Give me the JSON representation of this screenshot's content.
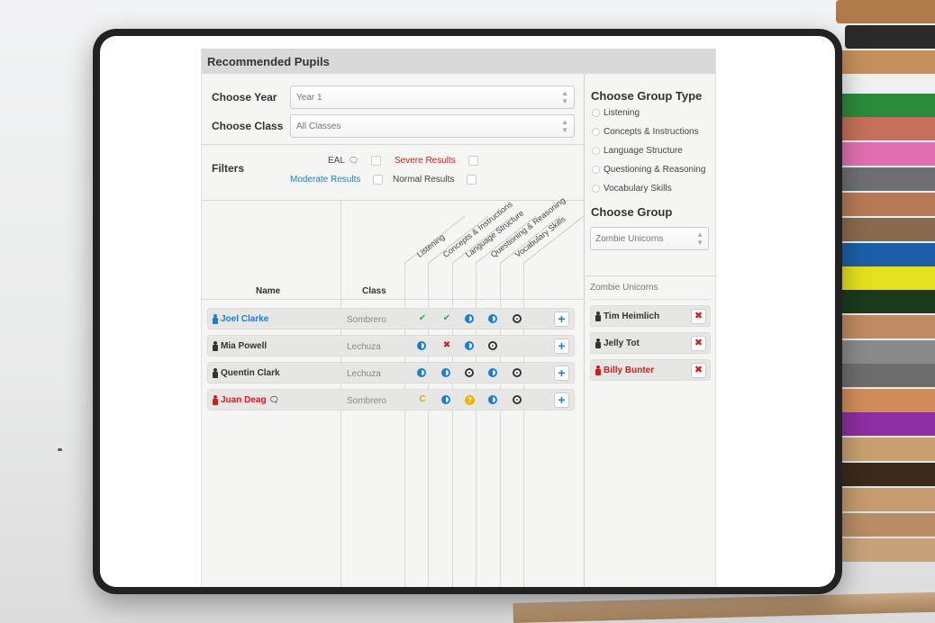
{
  "header": {
    "title": "Recommended Pupils"
  },
  "selectors": {
    "year_label": "Choose Year",
    "year_value": "Year 1",
    "class_label": "Choose Class",
    "class_value": "All Classes"
  },
  "filters": {
    "label": "Filters",
    "eal": "EAL",
    "severe": "Severe Results",
    "moderate": "Moderate Results",
    "normal": "Normal Results"
  },
  "table": {
    "name_header": "Name",
    "class_header": "Class",
    "skill_headers": [
      "Listening",
      "Concepts & Instructions",
      "Language Structure",
      "Questioning & Reasoning",
      "Vocabulary Skills"
    ],
    "rows": [
      {
        "name": "Joel Clarke",
        "class": "Sombrero",
        "color": "#1a7ed6",
        "eal": false,
        "scores": [
          "check",
          "check",
          "half",
          "half",
          "target"
        ]
      },
      {
        "name": "Mia Powell",
        "class": "Lechuza",
        "color": "#333333",
        "eal": false,
        "scores": [
          "half",
          "cross",
          "half",
          "target",
          ""
        ]
      },
      {
        "name": "Quentin Clark",
        "class": "Lechuza",
        "color": "#333333",
        "eal": false,
        "scores": [
          "half",
          "half",
          "target",
          "half",
          "target"
        ]
      },
      {
        "name": "Juan Deag",
        "class": "Sombrero",
        "color": "#d21c1c",
        "eal": true,
        "scores": [
          "cycle",
          "half",
          "question",
          "half",
          "target"
        ]
      }
    ],
    "add_label": "+"
  },
  "group_type": {
    "title": "Choose Group Type",
    "options": [
      "Listening",
      "Concepts & Instructions",
      "Language Structure",
      "Questioning & Reasoning",
      "Vocabulary Skills"
    ]
  },
  "group": {
    "title": "Choose Group",
    "selected": "Zombie Unicorns",
    "name": "Zombie Unicorns",
    "members": [
      {
        "name": "Tim Heimlich",
        "color": "#333333"
      },
      {
        "name": "Jelly Tot",
        "color": "#333333"
      },
      {
        "name": "Billy Bunter",
        "color": "#d21c1c"
      }
    ],
    "remove_label": "✖"
  },
  "icons": {
    "check": "✔",
    "cross": "✖",
    "cycle": "C",
    "question": "?",
    "bubble": "🗨",
    "person": "person-icon",
    "target": "target-icon",
    "half": "half-circle-icon"
  }
}
